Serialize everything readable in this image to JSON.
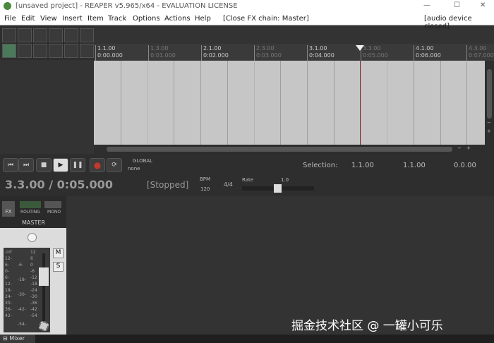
{
  "window": {
    "title": "[unsaved project] - REAPER v5.965/x64 - EVALUATION LICENSE",
    "minimize_glyph": "—",
    "maximize_glyph": "☐",
    "close_glyph": "✕"
  },
  "menu": {
    "items": [
      "File",
      "Edit",
      "View",
      "Insert",
      "Item",
      "Track",
      "Options",
      "Actions",
      "Help"
    ],
    "fx_chain": "[Close FX chain: Master]",
    "audio_status": "[audio device closed]"
  },
  "ruler": {
    "marks": [
      {
        "bar": "1.1.00",
        "time": "0:00.000",
        "dim": false
      },
      {
        "bar": "1.3.00",
        "time": "0:01.000",
        "dim": true
      },
      {
        "bar": "2.1.00",
        "time": "0:02.000",
        "dim": false
      },
      {
        "bar": "2.3.00",
        "time": "0:03.000",
        "dim": true
      },
      {
        "bar": "3.1.00",
        "time": "0:04.000",
        "dim": false
      },
      {
        "bar": "3.3.00",
        "time": "0:05.000",
        "dim": true
      },
      {
        "bar": "4.1.00",
        "time": "0:06.000",
        "dim": false
      },
      {
        "bar": "4.3.00",
        "time": "0:07.000",
        "dim": true
      }
    ]
  },
  "transport": {
    "position": "3.3.00 / 0:05.000",
    "status": "[Stopped]",
    "bpm_label": "BPM",
    "bpm": "120",
    "timesig": "4/4",
    "rate_label": "Rate",
    "rate": "1.0",
    "global_label": "GLOBAL",
    "global_value": "none",
    "selection_label": "Selection:",
    "sel_start": "1.1.00",
    "sel_end": "1.1.00",
    "sel_length": "0.0.00"
  },
  "mixer": {
    "fx": "FX",
    "routing": "ROUTING",
    "mono": "MONO",
    "master_label": "MASTER",
    "m": "M",
    "s": "S",
    "scale_left": [
      "-inf",
      "12-",
      "6-",
      "0-",
      "6-",
      "12-",
      "18-",
      "24-",
      "30-",
      "36-",
      "42-"
    ],
    "scale_mid": [
      "-6-",
      "-18-",
      "-30-",
      "-42-",
      "-54-"
    ],
    "scale_right": [
      "12",
      "6",
      "0",
      "-6",
      "-12",
      "-18",
      "-24",
      "-30",
      "-36",
      "-42",
      "-54"
    ],
    "tab_label": "Mixer"
  },
  "watermark": "掘金技术社区 @ 一罐小可乐",
  "colors": {
    "arrange_bg": "#c6c6c6",
    "playhead": "#7a2222",
    "record": "#c0392b"
  }
}
